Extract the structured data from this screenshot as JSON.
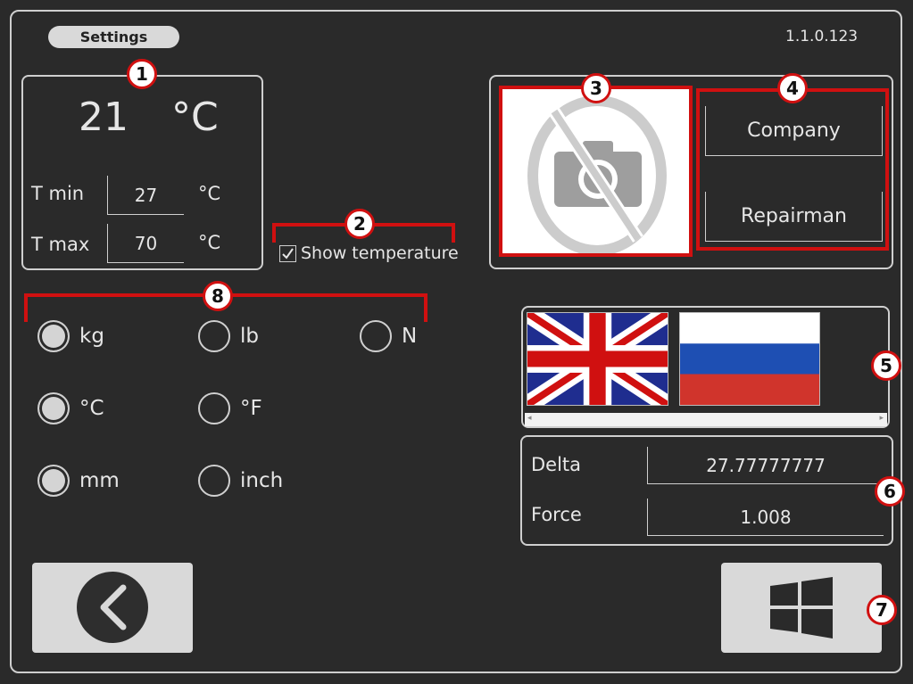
{
  "header": {
    "tab_label": "Settings",
    "version": "1.1.0.123"
  },
  "temperature": {
    "current_value": "21",
    "current_unit": "°C",
    "tmin_label": "T min",
    "tmin_value": "27",
    "tmin_unit": "°C",
    "tmax_label": "T max",
    "tmax_value": "70",
    "tmax_unit": "°C"
  },
  "show_temperature": {
    "label": "Show temperature",
    "checked": true
  },
  "units": {
    "row1": [
      {
        "label": "kg",
        "selected": true
      },
      {
        "label": "lb",
        "selected": false
      },
      {
        "label": "N",
        "selected": false
      }
    ],
    "row2": [
      {
        "label": "°C",
        "selected": true
      },
      {
        "label": "°F",
        "selected": false
      }
    ],
    "row3": [
      {
        "label": "mm",
        "selected": true
      },
      {
        "label": "inch",
        "selected": false
      }
    ]
  },
  "profile": {
    "company_label": "Company",
    "repairman_label": "Repairman"
  },
  "languages": [
    "English (UK flag)",
    "Russian (RU flag)"
  ],
  "calibration": {
    "delta_label": "Delta",
    "delta_value": "27.77777777",
    "force_label": "Force",
    "force_value": "1.008"
  },
  "badges": [
    "1",
    "2",
    "3",
    "4",
    "5",
    "6",
    "7",
    "8"
  ],
  "colors": {
    "background": "#2a2a2a",
    "accent_red": "#d01010",
    "button_gray": "#d9d9d9"
  }
}
